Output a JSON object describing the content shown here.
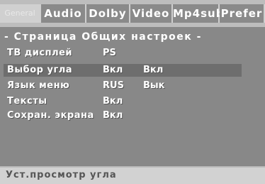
{
  "tabs": [
    "General",
    "Audio",
    "Dolby",
    "Video",
    "Mp4sub",
    "Prefer"
  ],
  "panel": {
    "title": "- Страница Общих настроек -",
    "rows": [
      {
        "label": "ТВ дисплей",
        "value": "PS",
        "option": ""
      },
      {
        "label": "Выбор угла",
        "value": "Вкл",
        "option": "Вкл"
      },
      {
        "label": "Язык меню",
        "value": "RUS",
        "option": "Вык"
      },
      {
        "label": "Тексты",
        "value": "Вкл",
        "option": ""
      },
      {
        "label": "Сохран. экрана",
        "value": "Вкл",
        "option": ""
      }
    ]
  },
  "status": {
    "text": "Уст.просмотр угла"
  },
  "colors": {
    "panel": "#888888",
    "highlight": "#6e6e6e",
    "tab_bg": "#8a8a8a",
    "status_bg": "#d2d2d2"
  }
}
